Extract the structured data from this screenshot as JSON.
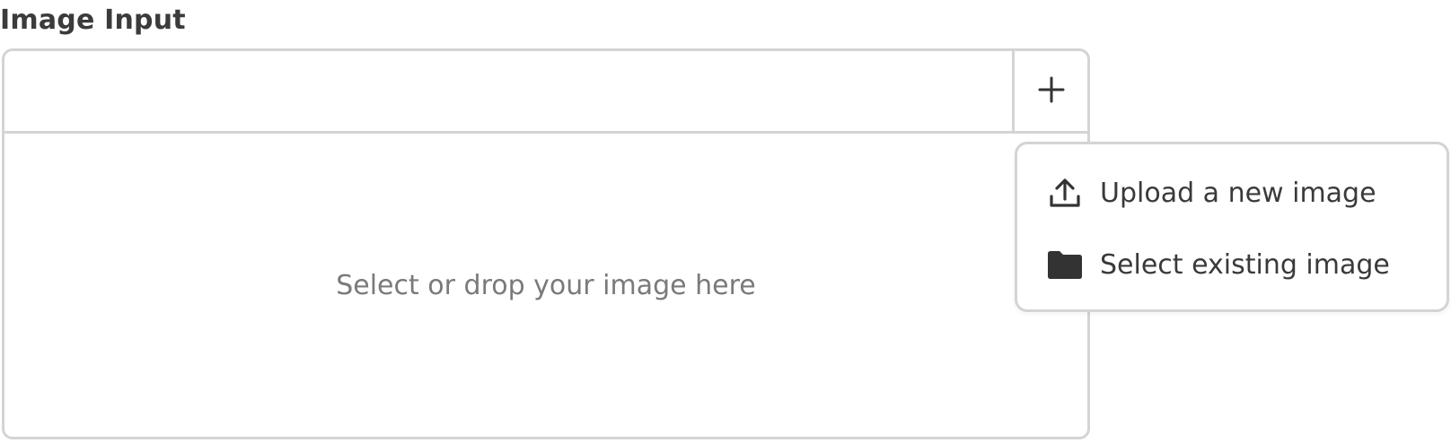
{
  "field": {
    "label": "Image Input"
  },
  "dropzone": {
    "text": "Select or drop your image here"
  },
  "add_button": {
    "icon": "plus-icon"
  },
  "menu": {
    "items": [
      {
        "label": "Upload a new image",
        "icon": "upload-icon"
      },
      {
        "label": "Select existing image",
        "icon": "folder-icon"
      }
    ]
  },
  "colors": {
    "border": "#d4d4d4",
    "text": "#3a3a3a",
    "muted_text": "#7a7a7a",
    "icon": "#333333"
  }
}
